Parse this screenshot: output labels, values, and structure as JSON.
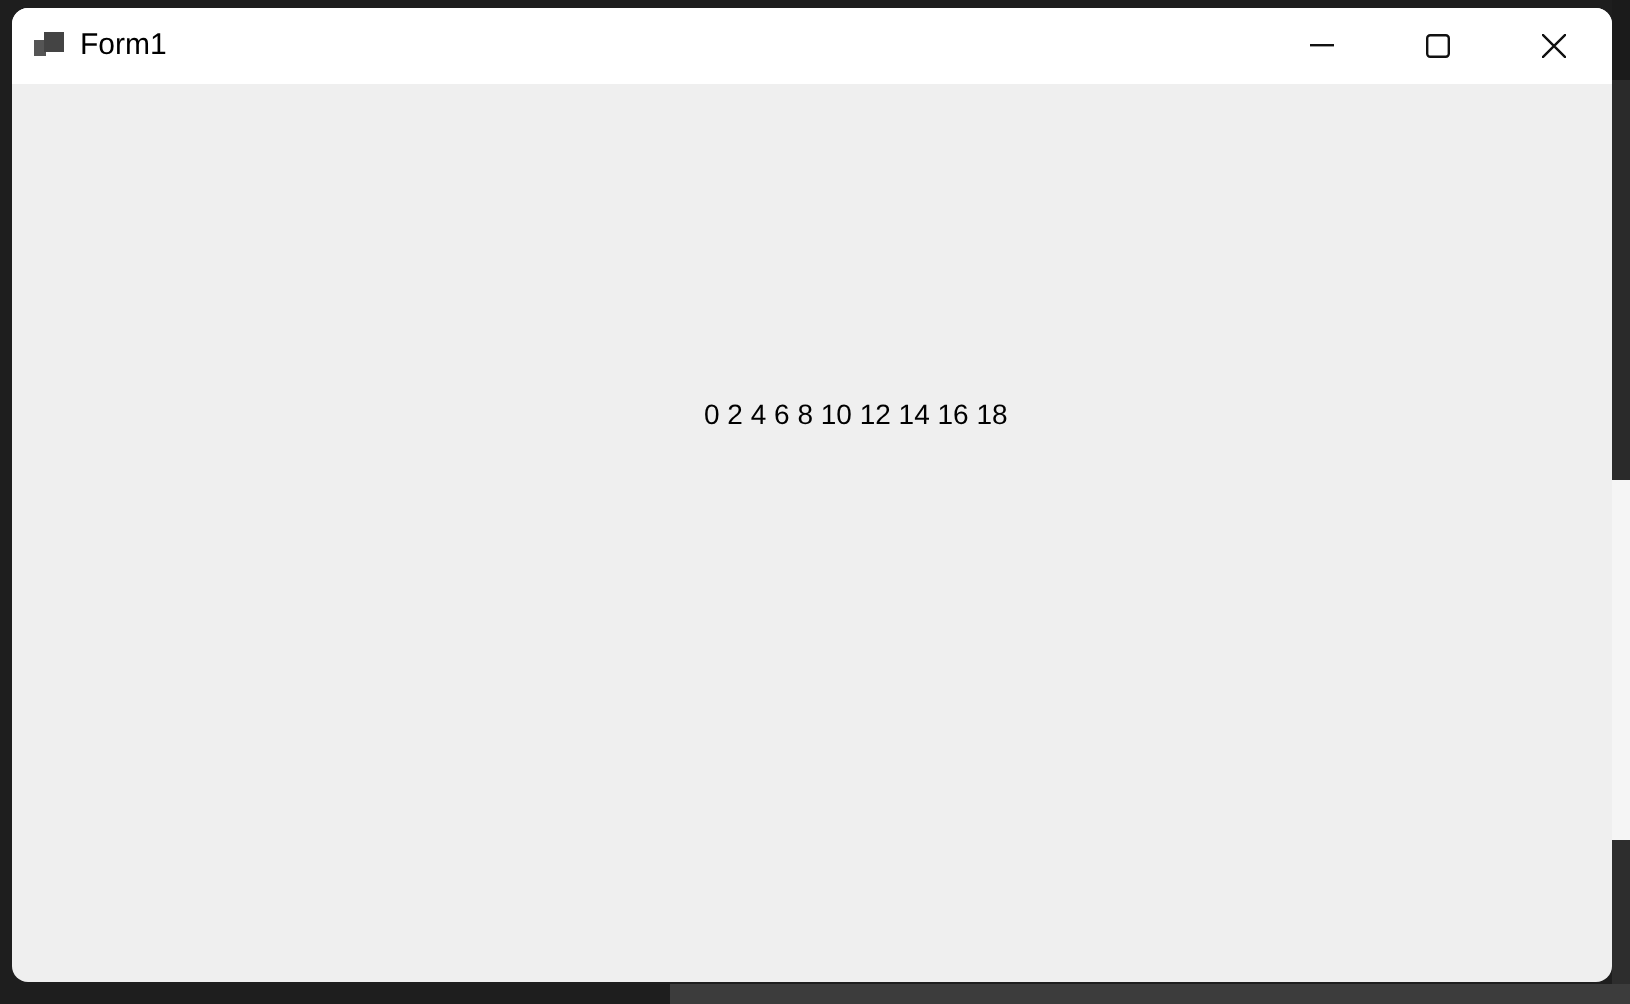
{
  "window": {
    "title": "Form1"
  },
  "label": {
    "text": "0 2 4 6 8 10 12 14 16 18"
  }
}
